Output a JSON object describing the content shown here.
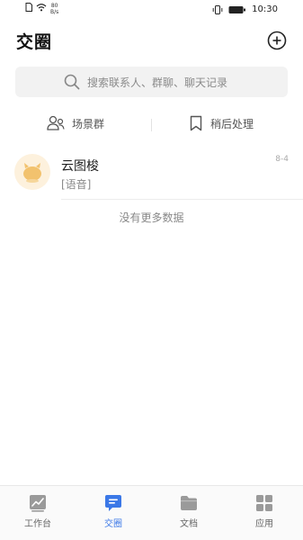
{
  "status_bar": {
    "net_speed_value": "80",
    "net_speed_unit": "B/s",
    "time": "10:30",
    "icons": [
      "sim-icon",
      "wifi-icon",
      "vibrate-icon",
      "battery-icon"
    ]
  },
  "header": {
    "title": "交圈",
    "add_icon": "plus-circle-icon"
  },
  "search": {
    "placeholder": "搜索联系人、群聊、聊天记录",
    "icon": "search-icon"
  },
  "quick_actions": [
    {
      "label": "场景群",
      "icon": "group-icon"
    },
    {
      "label": "稍后处理",
      "icon": "bookmark-icon"
    }
  ],
  "conversations": [
    {
      "name": "云图梭",
      "last_message": "[语音]",
      "date": "8-4",
      "avatar_icon": "bot-avatar-icon"
    }
  ],
  "empty_hint": "没有更多数据",
  "tabs": [
    {
      "label": "工作台",
      "icon": "workbench-icon",
      "active": false
    },
    {
      "label": "交圈",
      "icon": "chat-icon",
      "active": true
    },
    {
      "label": "文档",
      "icon": "folder-icon",
      "active": false
    },
    {
      "label": "应用",
      "icon": "apps-icon",
      "active": false
    }
  ],
  "colors": {
    "accent": "#3b78e7",
    "avatar_bg": "#fdf1dd",
    "avatar_fg": "#f2c26e"
  }
}
